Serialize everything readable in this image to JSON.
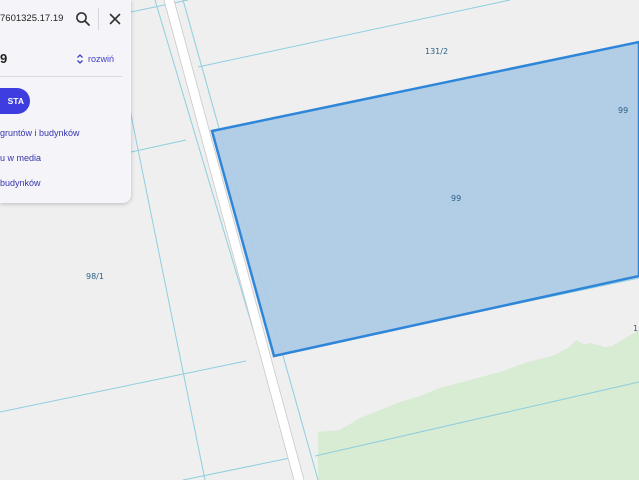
{
  "search": {
    "value": "7601325.17.19"
  },
  "parcel": {
    "title": "9",
    "expand_label": "rozwiń"
  },
  "actions": {
    "primary_label": "STA",
    "links": [
      "gruntów i budynków",
      "u w media",
      "budynków"
    ]
  },
  "map": {
    "labels": [
      "131/2",
      "99",
      "99",
      "98/1",
      "1"
    ],
    "colors": {
      "background": "#efefef",
      "parcel_line": "#8ecfdf",
      "selected_fill": "#aecbe6",
      "selected_stroke": "#2f86d8",
      "forest": "#d8ebd3",
      "road": "#ffffff",
      "accent": "#3d3de0"
    }
  }
}
